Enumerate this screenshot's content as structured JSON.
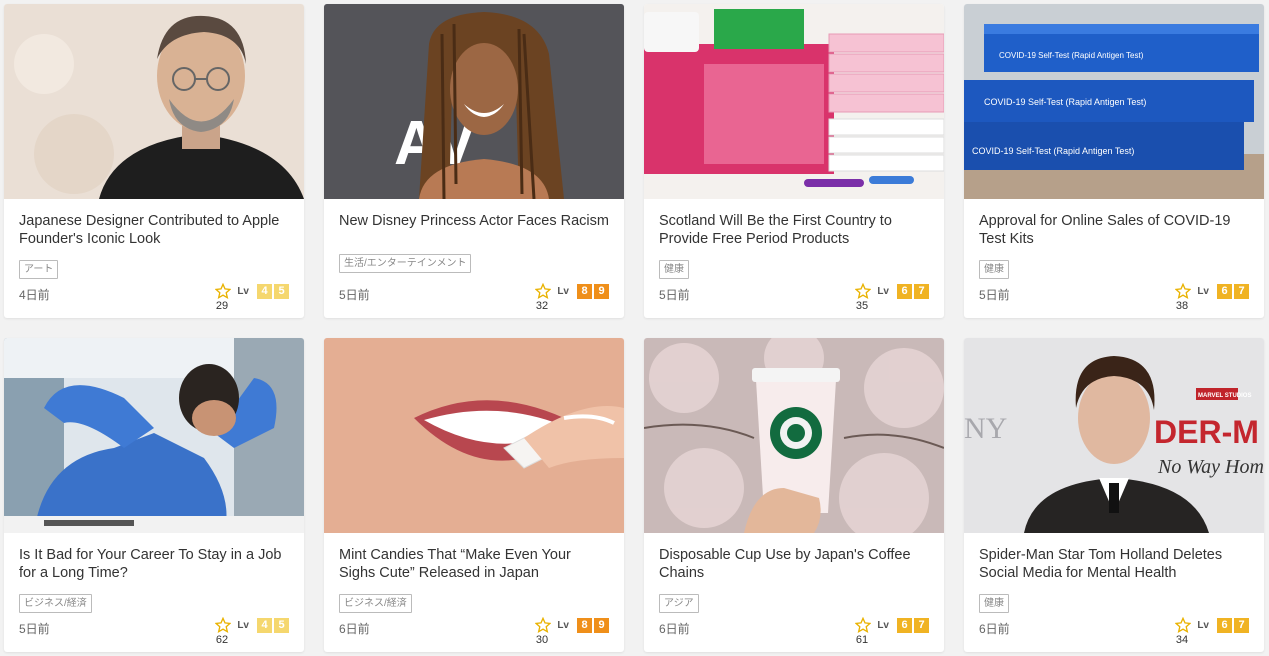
{
  "colors": {
    "lv_light": "#f5d76e",
    "lv_mid": "#f0b323",
    "lv_orange": "#ef8f1a",
    "star": "#e9b200"
  },
  "level_label": "Lv",
  "cards": [
    {
      "title": "Japanese Designer Contributed to Apple Founder's Iconic Look",
      "tag": "アート",
      "date": "4日前",
      "level": [
        "4",
        "5"
      ],
      "badge_color": "lv_light",
      "count": "29",
      "image": "portrait-man-turtleneck"
    },
    {
      "title": "New Disney Princess Actor Faces Racism",
      "tag": "生活/エンターテインメント",
      "date": "5日前",
      "level": [
        "8",
        "9"
      ],
      "badge_color": "lv_orange",
      "count": "32",
      "image": "portrait-woman-locs",
      "image_text": "AV"
    },
    {
      "title": "Scotland Will Be the First Country to Provide Free Period Products",
      "tag": "健康",
      "date": "5日前",
      "level": [
        "6",
        "7"
      ],
      "badge_color": "lv_mid",
      "count": "35",
      "image": "period-products"
    },
    {
      "title": "Approval for Online Sales of COVID-19 Test Kits",
      "tag": "健康",
      "date": "5日前",
      "level": [
        "6",
        "7"
      ],
      "badge_color": "lv_mid",
      "count": "38",
      "image": "test-kit-boxes",
      "image_text": "COVID-19 Self-Test (Rapid Antigen Test)"
    },
    {
      "title": "Is It Bad for Your Career To Stay in a Job for a Long Time?",
      "tag": "ビジネス/経済",
      "date": "5日前",
      "level": [
        "4",
        "5"
      ],
      "badge_color": "lv_light",
      "count": "62",
      "image": "office-man-stretch"
    },
    {
      "title": "Mint Candies That “Make Even Your Sighs Cute” Released in Japan",
      "tag": "ビジネス/経済",
      "date": "6日前",
      "level": [
        "8",
        "9"
      ],
      "badge_color": "lv_orange",
      "count": "30",
      "image": "smile-gum"
    },
    {
      "title": "Disposable Cup Use by Japan's Coffee Chains",
      "tag": "アジア",
      "date": "6日前",
      "level": [
        "6",
        "7"
      ],
      "badge_color": "lv_mid",
      "count": "61",
      "image": "coffee-cup-blossoms"
    },
    {
      "title": "Spider-Man Star Tom Holland Deletes Social Media for Mental Health",
      "tag": "健康",
      "date": "6日前",
      "level": [
        "6",
        "7"
      ],
      "badge_color": "lv_mid",
      "count": "34",
      "image": "premiere-portrait",
      "image_text": [
        "NY",
        "MARVEL STUDIOS",
        "DER-M",
        "No Way Hom"
      ]
    }
  ]
}
